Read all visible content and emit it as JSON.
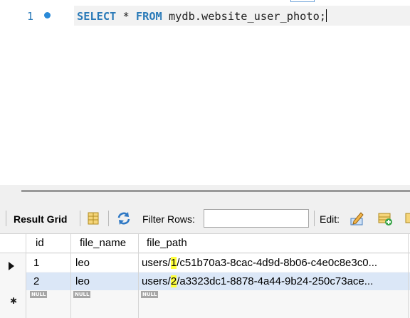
{
  "editor": {
    "line_number": "1",
    "sql": {
      "kw_select": "SELECT",
      "star": " * ",
      "kw_from": "FROM",
      "rest": " mydb.website_user_photo;"
    }
  },
  "toolbar": {
    "result_grid": "Result Grid",
    "filter_rows_label": "Filter Rows:",
    "filter_rows_value": "",
    "edit_label": "Edit:"
  },
  "grid": {
    "columns": [
      "id",
      "file_name",
      "file_path"
    ],
    "rows": [
      {
        "id": "1",
        "file_name": "leo",
        "path_prefix": "users/",
        "path_highlight": "1",
        "path_rest": "/c51b70a3-8cac-4d9d-8b06-c4e0c8e3c0..."
      },
      {
        "id": "2",
        "file_name": "leo",
        "path_prefix": "users/",
        "path_highlight": "2",
        "path_rest": "/a3323dc1-8878-4a44-9b24-250c73ace..."
      }
    ],
    "null_label": "NULL"
  },
  "colors": {
    "keyword": "#2a7ab8",
    "highlight": "#ffff3c",
    "selected_row": "#dbe7f7"
  }
}
